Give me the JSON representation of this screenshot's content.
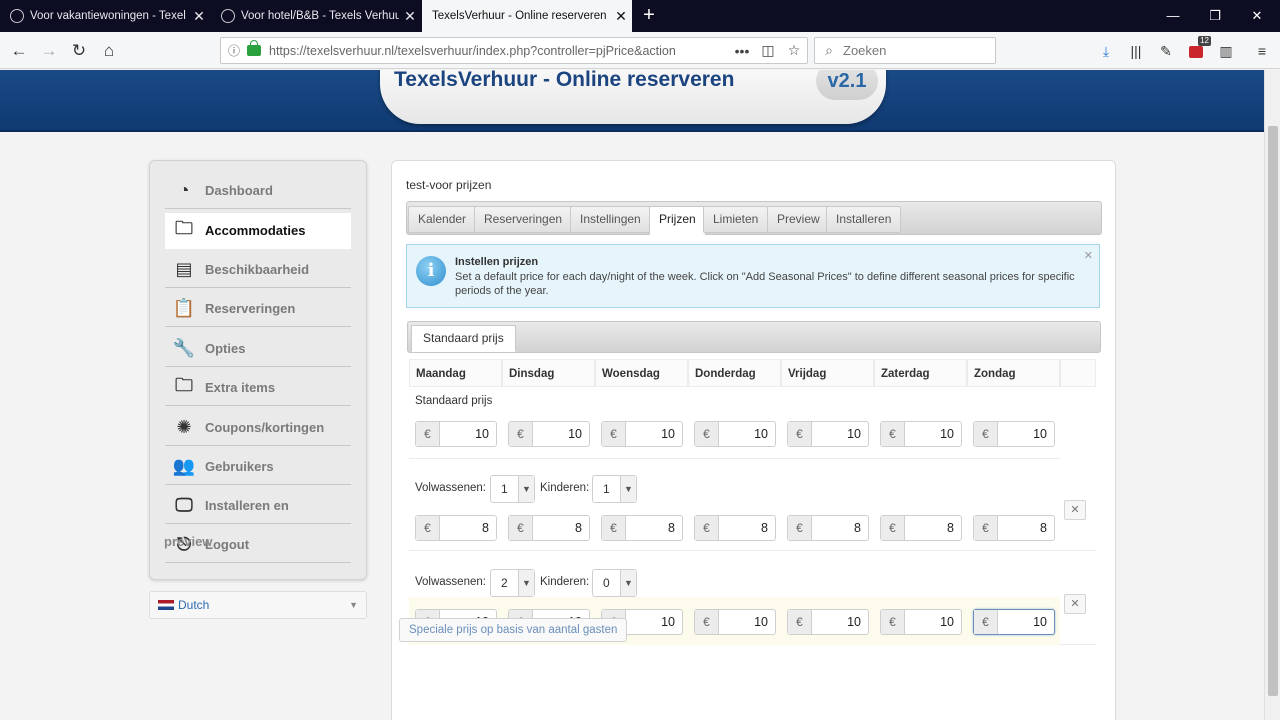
{
  "browser": {
    "tabs": [
      {
        "title": "Voor vakantiewoningen - Texel",
        "active": false
      },
      {
        "title": "Voor hotel/B&B - Texels Verhuur",
        "active": false
      },
      {
        "title": "TexelsVerhuur - Online reserveren",
        "active": true
      }
    ],
    "url": "https://texelsverhuur.nl/texelsverhuur/index.php?controller=pjPrice&action",
    "search_placeholder": "Zoeken",
    "badge_count": "12"
  },
  "app": {
    "title": "TexelsVerhuur - Online reserveren",
    "version": "v2.1"
  },
  "sidebar": {
    "items": [
      {
        "label": "Dashboard",
        "icon": "dashboard-icon"
      },
      {
        "label": "Accommodaties",
        "icon": "folder-icon"
      },
      {
        "label": "Beschikbaarheid",
        "icon": "document-icon"
      },
      {
        "label": "Reserveringen",
        "icon": "clipboard-icon"
      },
      {
        "label": "Opties",
        "icon": "wrench-icon"
      },
      {
        "label": "Extra items",
        "icon": "folder-add-icon"
      },
      {
        "label": "Coupons/kortingen",
        "icon": "percent-badge-icon"
      },
      {
        "label": "Gebruikers",
        "icon": "users-icon"
      },
      {
        "label": "Installeren en",
        "icon": "monitor-icon"
      },
      {
        "label": "Logout",
        "icon": "logout-icon"
      }
    ],
    "overlap_text": "preview",
    "language": "Dutch"
  },
  "main": {
    "page_title": "test-voor prijzen",
    "tabs": [
      "Kalender",
      "Reserveringen",
      "Instellingen",
      "Prijzen",
      "Limieten",
      "Preview",
      "Installeren"
    ],
    "active_tab": "Prijzen",
    "info": {
      "title": "Instellen prijzen",
      "text": "Set a default price for each day/night of the week. Click on \"Add Seasonal Prices\" to define different seasonal prices for specific periods of the year."
    },
    "subtab": "Standaard prijs",
    "days": [
      "Maandag",
      "Dinsdag",
      "Woensdag",
      "Donderdag",
      "Vrijdag",
      "Zaterdag",
      "Zondag"
    ],
    "currency": "€",
    "default_row_label": "Standaard prijs",
    "default_prices": [
      "10",
      "10",
      "10",
      "10",
      "10",
      "10",
      "10"
    ],
    "adults_label": "Volwassenen:",
    "children_label": "Kinderen:",
    "guest_rows": [
      {
        "adults": "1",
        "children": "1",
        "prices": [
          "8",
          "8",
          "8",
          "8",
          "8",
          "8",
          "8"
        ]
      },
      {
        "adults": "2",
        "children": "0",
        "prices": [
          "10",
          "10",
          "10",
          "10",
          "10",
          "10",
          "10"
        ]
      }
    ],
    "special_button": "Speciale prijs op basis van aantal gasten"
  }
}
